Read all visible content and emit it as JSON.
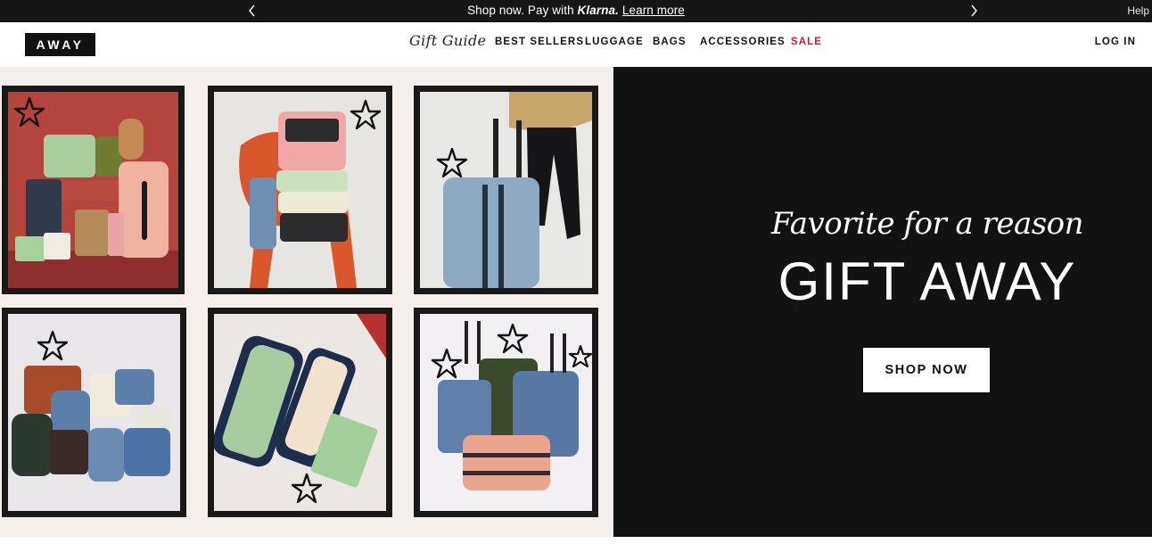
{
  "promo": {
    "text_before": "Shop now. Pay with ",
    "brand": "Klarna.",
    "link": "Learn more",
    "help": "Help",
    "prev_icon": "chevron-left-icon",
    "next_icon": "chevron-right-icon"
  },
  "header": {
    "logo": "AWAY",
    "gift_guide": "Gift Guide",
    "nav": [
      "BEST SELLERS",
      "LUGGAGE",
      "BAGS",
      "ACCESSORIES",
      "SALE"
    ],
    "login": "LOG IN",
    "sale_color": "#c2203a"
  },
  "hero": {
    "tagline": "Favorite for a reason",
    "headline": "GIFT AWAY",
    "cta": "SHOP NOW",
    "panel_color": "#121212",
    "collage_bg": "#f4efea",
    "tiles": [
      {
        "subject": "stacked pastel luggage and pouches on red backdrop",
        "icon": "star-icon"
      },
      {
        "subject": "toiletry case and packing cubes on orange chair",
        "icon": "star-icon"
      },
      {
        "subject": "person with blue carry-on suitcase",
        "icon": "star-icon"
      },
      {
        "subject": "assorted bags and backpacks",
        "icon": "star-icon"
      },
      {
        "subject": "open navy suitcase with green packing pouches",
        "icon": "star-icon"
      },
      {
        "subject": "set of blue, green and pink suitcases",
        "icon": "star-icon"
      }
    ]
  }
}
